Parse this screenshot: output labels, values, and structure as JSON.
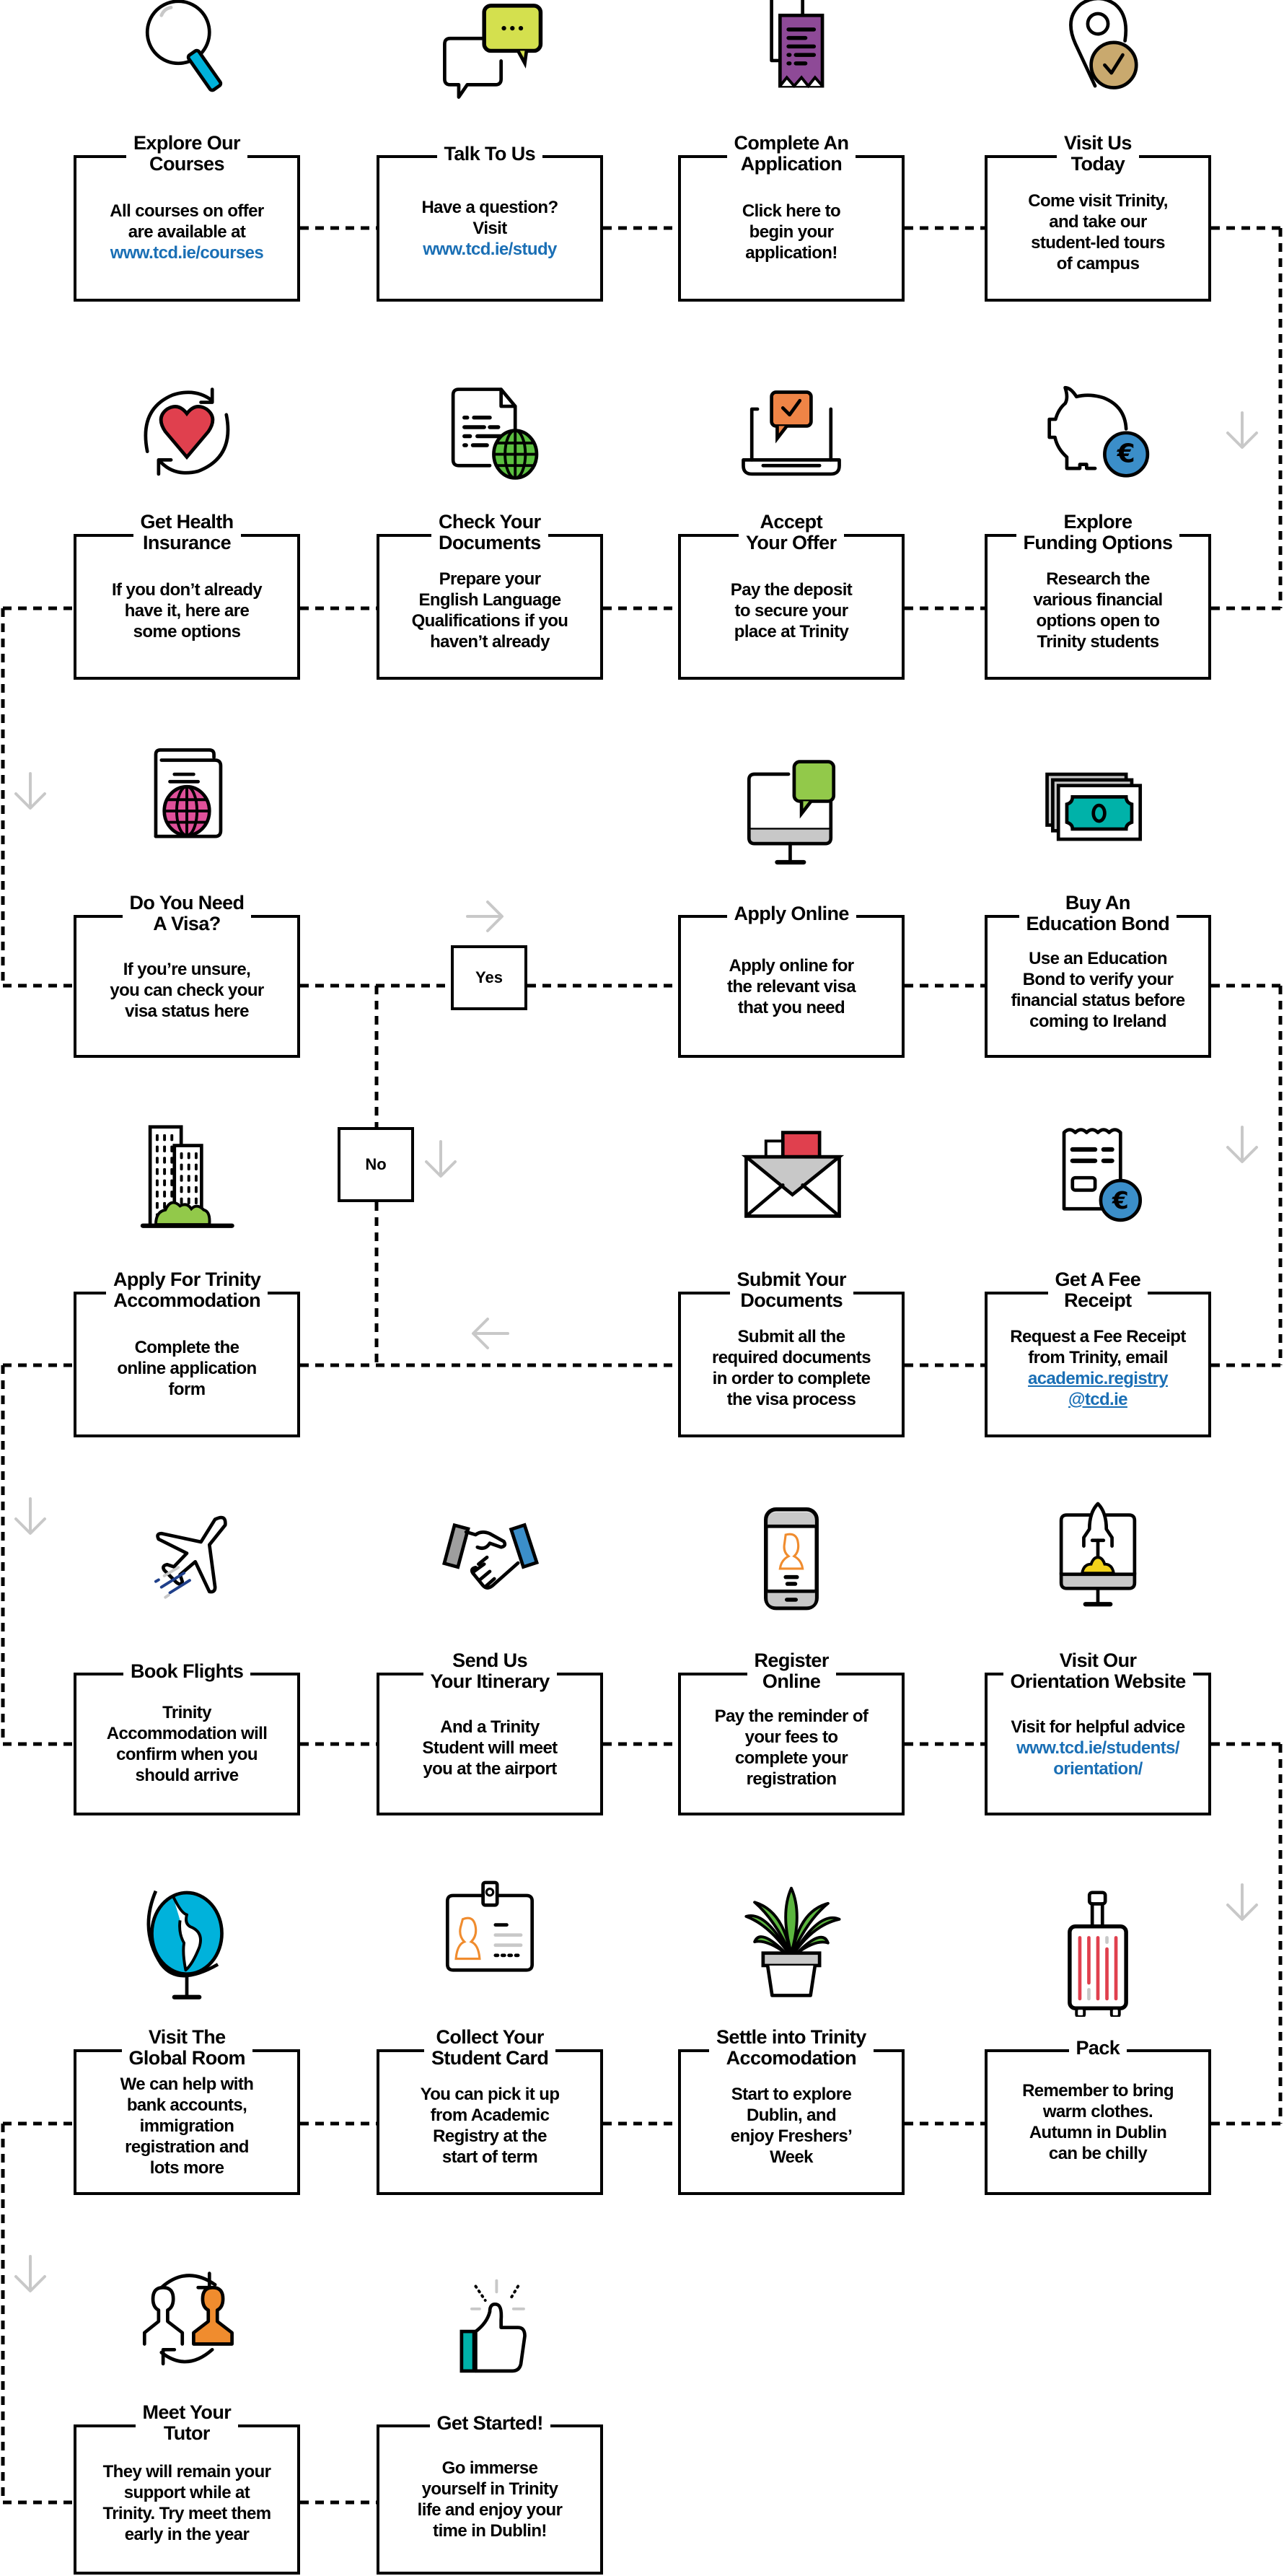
{
  "colors": {
    "link": "#1a6fb5",
    "arrow": "#c8c8c8",
    "stroke": "#000000",
    "magnifier_handle": "#00b2db",
    "chat_yellow": "#d4e04e",
    "receipt_purple": "#8e4a97",
    "pin_gold": "#c9a96e",
    "heart_red": "#e0404e",
    "globe_green": "#5bbf40",
    "chat_orange": "#ef8446",
    "euro_blue": "#3b8ec9",
    "passport_pink": "#e0509a",
    "monitor_green": "#92c94a",
    "money_teal": "#00b2a9",
    "building_green": "#92c94a",
    "envelope_red": "#e0404e",
    "hand_blue": "#3b8ec9",
    "person_orange": "#f08c2e",
    "rocket_yellow": "#f2d21a",
    "globe_blue": "#00b2db",
    "plant_green": "#5bb53e",
    "suitcase_red": "#e0404e",
    "thumb_teal": "#00b2a9"
  },
  "steps": [
    {
      "id": "explore-courses",
      "icon": "magnifier-icon",
      "title": "Explore Our\nCourses",
      "body": "All courses on offer\nare available at",
      "link": "www.tcd.ie/courses",
      "link_underlined": false
    },
    {
      "id": "talk-to-us",
      "icon": "chat-bubbles-icon",
      "title": "Talk To Us",
      "body": "Have a question?\nVisit",
      "link": "www.tcd.ie/study",
      "link_underlined": false
    },
    {
      "id": "complete-application",
      "icon": "receipt-document-icon",
      "title": "Complete An\nApplication",
      "body": "Click here to\nbegin your\napplication!",
      "link": "",
      "link_underlined": false
    },
    {
      "id": "visit-us-today",
      "icon": "location-pin-check-icon",
      "title": "Visit Us\nToday",
      "body": "Come visit Trinity,\nand take our\nstudent-led tours\nof campus",
      "link": "",
      "link_underlined": false
    },
    {
      "id": "explore-funding",
      "icon": "piggy-bank-euro-icon",
      "title": "Explore\nFunding Options",
      "body": "Research the\nvarious financial\noptions open to\nTrinity students",
      "link": "",
      "link_underlined": false
    },
    {
      "id": "accept-offer",
      "icon": "laptop-check-icon",
      "title": "Accept\nYour Offer",
      "body": "Pay the deposit\nto secure your\nplace at Trinity",
      "link": "",
      "link_underlined": false
    },
    {
      "id": "check-documents",
      "icon": "document-globe-icon",
      "title": "Check Your\nDocuments",
      "body": "Prepare your\nEnglish Language\nQualifications if you\nhaven’t already",
      "link": "",
      "link_underlined": false
    },
    {
      "id": "health-insurance",
      "icon": "heart-cycle-icon",
      "title": "Get Health\nInsurance",
      "body": "If you don’t already\nhave it, here are\nsome options",
      "link": "",
      "link_underlined": false
    },
    {
      "id": "need-visa",
      "icon": "passport-icon",
      "title": "Do You Need\nA Visa?",
      "body": "If you’re unsure,\nyou can check your\nvisa status here",
      "link": "",
      "link_underlined": false
    },
    {
      "id": "apply-online",
      "icon": "monitor-chat-icon",
      "title": "Apply Online",
      "body": "Apply online for\nthe relevant visa\nthat you need",
      "link": "",
      "link_underlined": false
    },
    {
      "id": "education-bond",
      "icon": "banknotes-icon",
      "title": "Buy An\nEducation Bond",
      "body": "Use an Education\nBond to verify your\nfinancial status before\ncoming to Ireland",
      "link": "",
      "link_underlined": false
    },
    {
      "id": "fee-receipt",
      "icon": "receipt-euro-icon",
      "title": "Get A Fee\nReceipt",
      "body": "Request a Fee Receipt\nfrom Trinity, email",
      "link": "academic.registry\n@tcd.ie",
      "link_underlined": true
    },
    {
      "id": "submit-documents",
      "icon": "envelope-icon",
      "title": "Submit Your\nDocuments",
      "body": "Submit all the\nrequired documents\nin order to complete\nthe visa process",
      "link": "",
      "link_underlined": false
    },
    {
      "id": "trinity-accommodation",
      "icon": "buildings-icon",
      "title": "Apply For  Trinity\nAccommodation",
      "body": "Complete the\nonline application\nform",
      "link": "",
      "link_underlined": false
    },
    {
      "id": "book-flights",
      "icon": "airplane-icon",
      "title": "Book Flights",
      "body": "Trinity\nAccommodation will\nconfirm when you\nshould arrive",
      "link": "",
      "link_underlined": false
    },
    {
      "id": "send-itinerary",
      "icon": "handshake-icon",
      "title": "Send Us\nYour Itinerary",
      "body": "And a Trinity\nStudent will meet\nyou at the airport",
      "link": "",
      "link_underlined": false
    },
    {
      "id": "register-online",
      "icon": "smartphone-profile-icon",
      "title": "Register\nOnline",
      "body": "Pay the reminder of\nyour fees to\ncomplete your\nregistration",
      "link": "",
      "link_underlined": false
    },
    {
      "id": "orientation-website",
      "icon": "monitor-rocket-icon",
      "title": "Visit Our\nOrientation Website",
      "body": "Visit for helpful advice",
      "link": "www.tcd.ie/students/\norientation/",
      "link_underlined": false
    },
    {
      "id": "pack",
      "icon": "suitcase-icon",
      "title": "Pack",
      "body": "Remember to bring\nwarm clothes.\nAutumn in Dublin\ncan be chilly",
      "link": "",
      "link_underlined": false
    },
    {
      "id": "settle-in",
      "icon": "potted-plant-icon",
      "title": "Settle into Trinity\nAccomodation",
      "body": "Start to explore\nDublin, and\nenjoy Freshers’\nWeek",
      "link": "",
      "link_underlined": false
    },
    {
      "id": "student-card",
      "icon": "id-badge-icon",
      "title": "Collect Your\nStudent Card",
      "body": "You can pick it up\nfrom Academic\nRegistry at the\nstart of term",
      "link": "",
      "link_underlined": false
    },
    {
      "id": "global-room",
      "icon": "desk-globe-icon",
      "title": "Visit The\nGlobal Room",
      "body": "We can help with\nbank accounts,\nimmigration\nregistration and\nlots more",
      "link": "",
      "link_underlined": false
    },
    {
      "id": "meet-tutor",
      "icon": "people-exchange-icon",
      "title": "Meet Your\nTutor",
      "body": "They will remain your\nsupport while at\nTrinity. Try meet them\nearly in the year",
      "link": "",
      "link_underlined": false
    },
    {
      "id": "get-started",
      "icon": "thumbs-up-icon",
      "title": "Get Started!",
      "body": "Go immerse\nyourself in Trinity\nlife and enjoy your\ntime in Dublin!",
      "link": "",
      "link_underlined": false
    }
  ],
  "decisions": {
    "yes_label": "Yes",
    "no_label": "No"
  }
}
